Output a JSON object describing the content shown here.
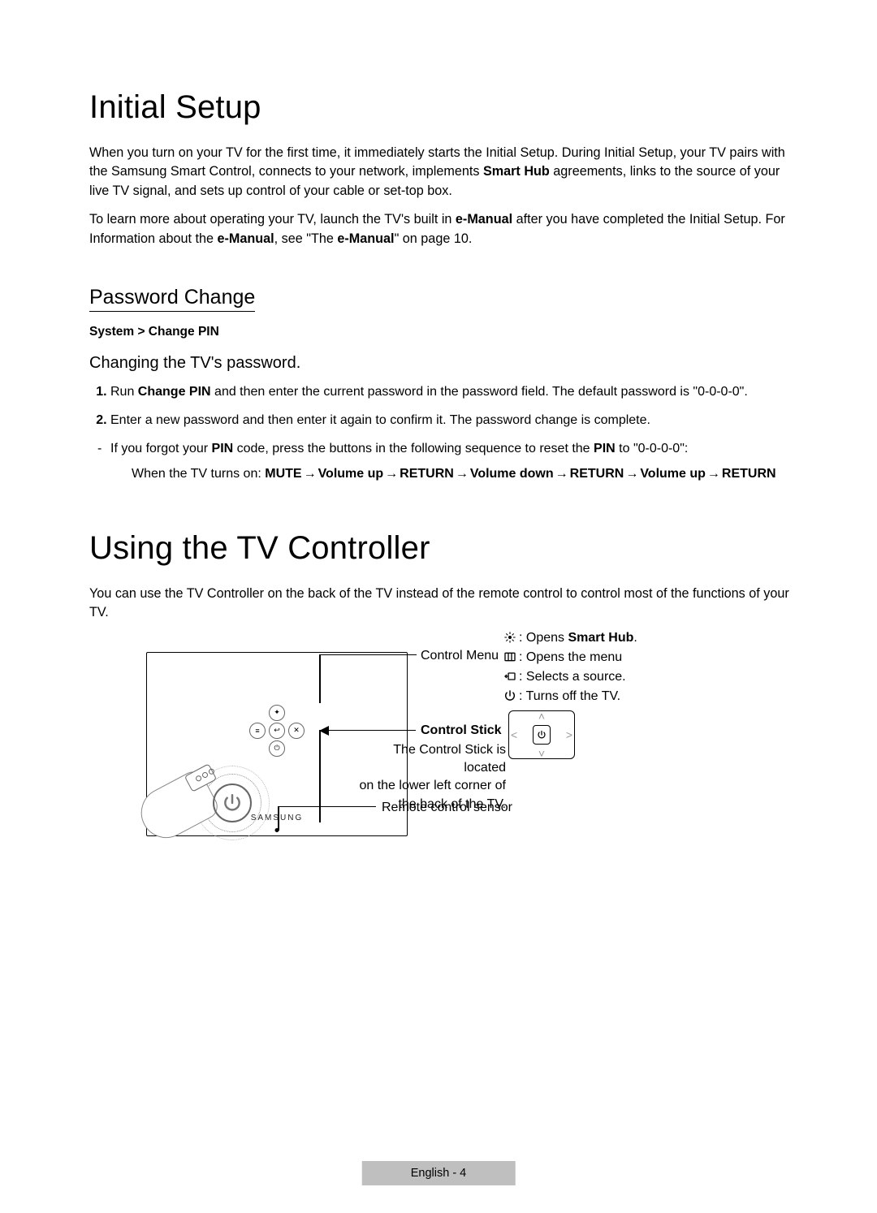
{
  "section1": {
    "title": "Initial Setup",
    "p1a": "When you turn on your TV for the first time, it immediately starts the Initial Setup. During Initial Setup, your TV pairs with the Samsung Smart Control, connects to your network, implements ",
    "p1b_bold": "Smart Hub",
    "p1c": " agreements, links to the source of your live TV signal, and sets up control of your cable or set-top box.",
    "p2a": "To learn more about operating your TV, launch the TV's built in ",
    "p2b_bold": "e-Manual",
    "p2c": " after you have completed the Initial Setup. For Information about the ",
    "p2d_bold": "e-Manual",
    "p2e": ", see \"The ",
    "p2f_bold": "e-Manual",
    "p2g": "\" on page 10."
  },
  "password": {
    "heading": "Password Change",
    "path": "System > Change PIN",
    "sub": "Changing the TV's password.",
    "step1a": "Run ",
    "step1b_bold": "Change PIN",
    "step1c": " and then enter the current password in the password field. The default password is \"0-0-0-0\".",
    "step2": "Enter a new password and then enter it again to confirm it. The password change is complete.",
    "bullet_a": "If you forgot your ",
    "bullet_b_bold": "PIN",
    "bullet_c": " code, press the buttons in the following sequence to reset the ",
    "bullet_d_bold": "PIN",
    "bullet_e": " to \"0-0-0-0\":",
    "seq_prefix": "When the TV turns on: ",
    "seq": [
      "MUTE",
      "Volume up",
      "RETURN",
      "Volume down",
      "RETURN",
      "Volume up",
      "RETURN"
    ]
  },
  "controller": {
    "title": "Using the TV Controller",
    "intro": "You can use the TV Controller on the back of the TV instead of the remote control to control most of the functions of your TV.",
    "label_control_menu": "Control Menu",
    "label_control_stick": "Control Stick",
    "stick_desc1": "The Control Stick is located",
    "stick_desc2": "on the lower left corner of",
    "stick_desc3": "the back of the TV.",
    "label_remote_sensor": "Remote control sensor",
    "legend": {
      "smarthub_pre": ": Opens ",
      "smarthub_bold": "Smart Hub",
      "smarthub_post": ".",
      "menu": ": Opens the menu",
      "source": ": Selects a source.",
      "power": ": Turns off the TV."
    },
    "brand": "SAMSUNG"
  },
  "footer": "English - 4"
}
